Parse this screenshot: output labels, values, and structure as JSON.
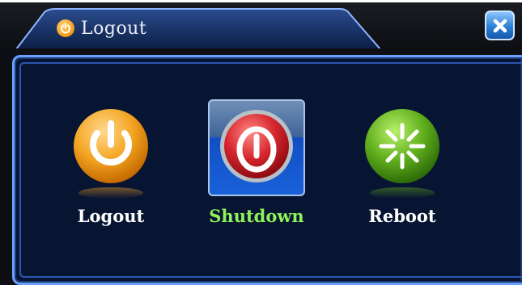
{
  "window": {
    "title": "Logout",
    "close_icon": "close-icon"
  },
  "options": [
    {
      "label": "Logout",
      "icon": "power-icon",
      "color": "#f5a623",
      "selected": false,
      "label_color": "#ffffff"
    },
    {
      "label": "Shutdown",
      "icon": "shutdown-icon",
      "color": "#d7262e",
      "selected": true,
      "label_color": "#8ff25a"
    },
    {
      "label": "Reboot",
      "icon": "reboot-icon",
      "color": "#62b01e",
      "selected": false,
      "label_color": "#ffffff"
    }
  ],
  "colors": {
    "panel_bg": "#081532",
    "panel_border": "#6aa0ff",
    "selected_label": "#8ff25a",
    "title_text": "#e9eef8"
  }
}
